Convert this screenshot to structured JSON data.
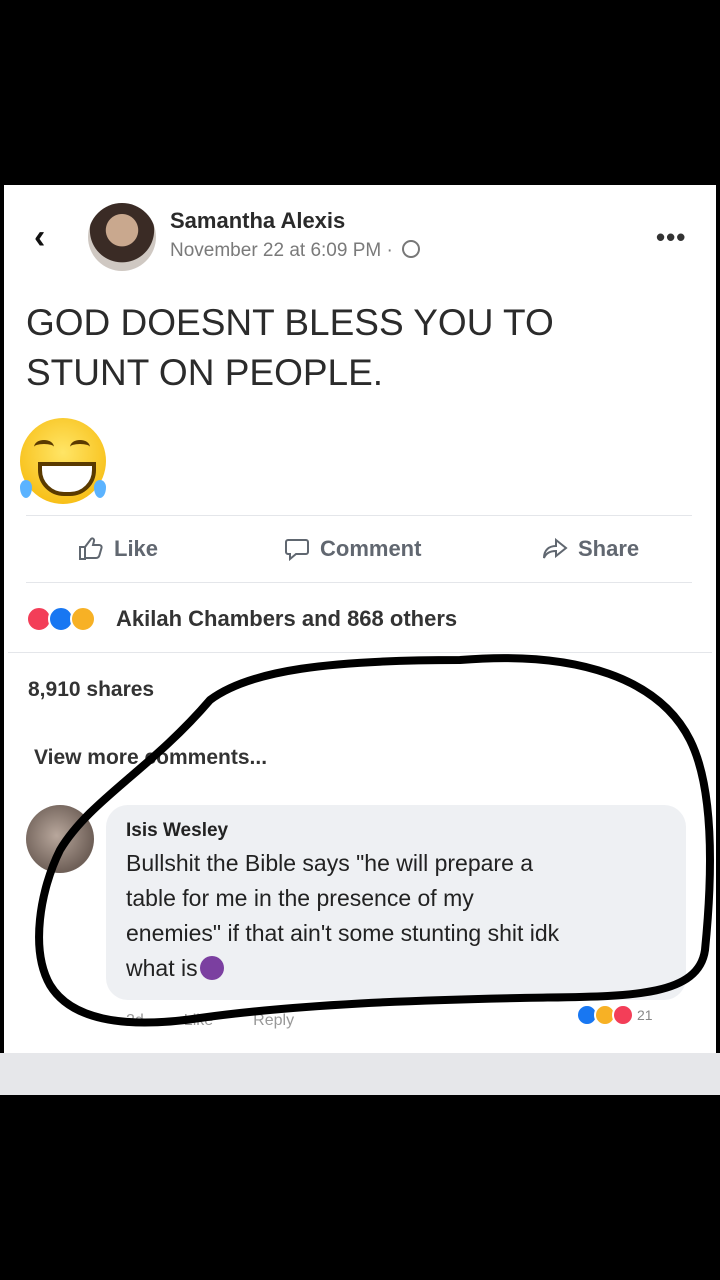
{
  "post": {
    "back_icon": "back-chevron-icon",
    "author": "Samantha Alexis",
    "timestamp": "November 22 at 6:09 PM · ",
    "privacy_icon": "globe-icon",
    "more_icon": "more-dots-icon",
    "more_label": "•••",
    "text_line1": "GOD DOESNT BLESS YOU TO",
    "text_line2": "STUNT ON PEOPLE.",
    "emoji": "face-with-tears-of-joy"
  },
  "actions": {
    "like": "Like",
    "comment": "Comment",
    "share": "Share"
  },
  "stats": {
    "reactions_text": "Akilah Chambers and 868 others",
    "shares": "8,910 shares",
    "view_more": "View more comments..."
  },
  "comment": {
    "author": "Isis Wesley",
    "line1": "Bullshit the Bible says \"he will prepare a",
    "line2": "table for me in the presence of my",
    "line3": "enemies\" if that ain't some stunting shit idk",
    "line4": "what is",
    "time": "2d",
    "like": "Like",
    "reply": "Reply",
    "reaction_count": "21"
  },
  "colors": {
    "like_blue": "#1877f2",
    "love_red": "#f33e58",
    "haha_yellow": "#f7b125",
    "annotation_ink": "#000000"
  }
}
